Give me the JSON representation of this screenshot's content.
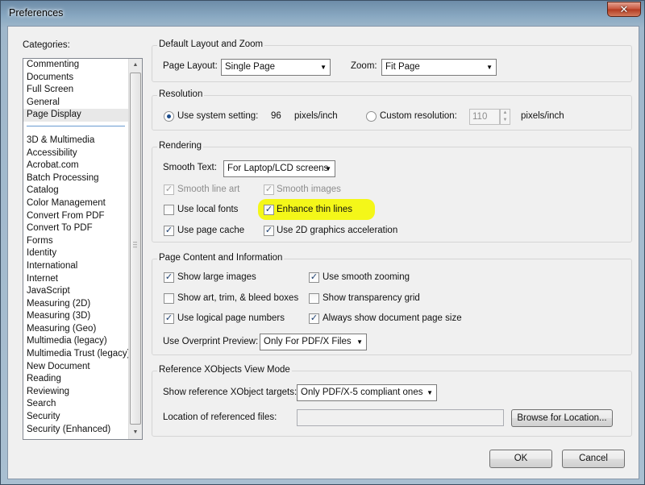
{
  "window": {
    "title": "Preferences",
    "close_glyph": "✕"
  },
  "categories": {
    "label": "Categories:",
    "top_items": [
      "Commenting",
      "Documents",
      "Full Screen",
      "General",
      "Page Display"
    ],
    "selected": "Page Display",
    "items": [
      "3D & Multimedia",
      "Accessibility",
      "Acrobat.com",
      "Batch Processing",
      "Catalog",
      "Color Management",
      "Convert From PDF",
      "Convert To PDF",
      "Forms",
      "Identity",
      "International",
      "Internet",
      "JavaScript",
      "Measuring (2D)",
      "Measuring (3D)",
      "Measuring (Geo)",
      "Multimedia (legacy)",
      "Multimedia Trust (legacy)",
      "New Document",
      "Reading",
      "Reviewing",
      "Search",
      "Security",
      "Security (Enhanced)"
    ]
  },
  "layout_zoom": {
    "title": "Default Layout and Zoom",
    "page_layout_label": "Page Layout:",
    "page_layout_value": "Single Page",
    "zoom_label": "Zoom:",
    "zoom_value": "Fit Page"
  },
  "resolution": {
    "title": "Resolution",
    "system_label": "Use system setting:",
    "system_value": "96",
    "system_unit": "pixels/inch",
    "custom_label": "Custom resolution:",
    "custom_value": "110",
    "custom_unit": "pixels/inch",
    "selected": "system"
  },
  "rendering": {
    "title": "Rendering",
    "smooth_text_label": "Smooth Text:",
    "smooth_text_value": "For Laptop/LCD screens",
    "smooth_line_art": {
      "label": "Smooth line art",
      "checked": true,
      "disabled": true
    },
    "smooth_images": {
      "label": "Smooth images",
      "checked": true,
      "disabled": true
    },
    "use_local_fonts": {
      "label": "Use local fonts",
      "checked": false
    },
    "enhance_thin_lines": {
      "label": "Enhance thin lines",
      "checked": true
    },
    "use_page_cache": {
      "label": "Use page cache",
      "checked": true
    },
    "use_2d_accel": {
      "label": "Use 2D graphics acceleration",
      "checked": true
    },
    "highlight_color": "#f4f719"
  },
  "page_content": {
    "title": "Page Content and Information",
    "show_large_images": {
      "label": "Show large images",
      "checked": true
    },
    "use_smooth_zooming": {
      "label": "Use smooth zooming",
      "checked": true
    },
    "show_art_trim": {
      "label": "Show art, trim, & bleed boxes",
      "checked": false
    },
    "show_transparency_grid": {
      "label": "Show transparency grid",
      "checked": false
    },
    "use_logical_page_numbers": {
      "label": "Use logical page numbers",
      "checked": true
    },
    "always_show_page_size": {
      "label": "Always show document page size",
      "checked": true
    },
    "overprint_label": "Use Overprint Preview:",
    "overprint_value": "Only For PDF/X Files"
  },
  "xobjects": {
    "title": "Reference XObjects View Mode",
    "targets_label": "Show reference XObject targets:",
    "targets_value": "Only PDF/X-5 compliant ones",
    "location_label": "Location of referenced files:",
    "location_value": "",
    "browse_label": "Browse for Location..."
  },
  "footer": {
    "ok_label": "OK",
    "cancel_label": "Cancel"
  },
  "colors": {
    "selection": "#e8e8e8",
    "accent_line": "#6a9bd1",
    "close_button": "#c7533a"
  }
}
